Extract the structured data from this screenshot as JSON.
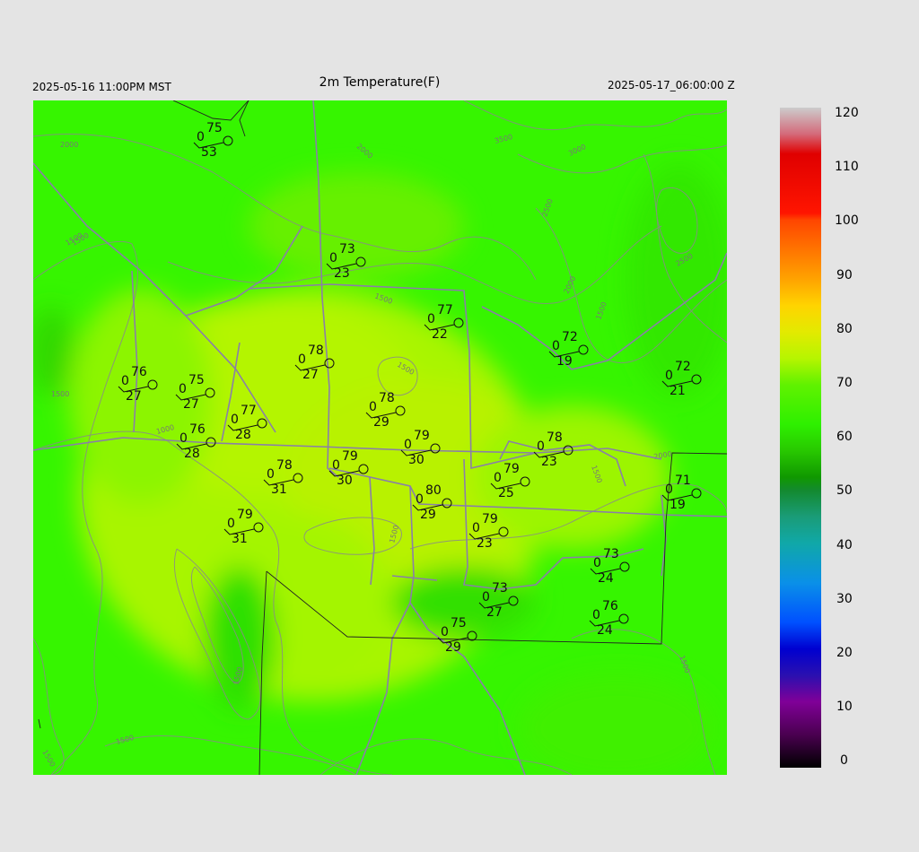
{
  "header": {
    "local_time": "2025-05-16 11:00PM MST",
    "title": "2m Temperature(F)",
    "utc_time": "2025-05-17_06:00:00 Z"
  },
  "colorbar": {
    "labels": [
      "120",
      "110",
      "100",
      "90",
      "80",
      "70",
      "60",
      "50",
      "40",
      "30",
      "20",
      "10",
      "0"
    ]
  },
  "contours": [
    "2000",
    "1500",
    "1000",
    "2000",
    "3500",
    "3000",
    "2500",
    "2000",
    "2500",
    "1500",
    "1500",
    "1500",
    "1500",
    "1500",
    "2000",
    "1500",
    "1500",
    "1500",
    "1500",
    "1500",
    "1500"
  ],
  "stations": [
    {
      "t": "75",
      "g": "0",
      "d": "53"
    },
    {
      "t": "73",
      "g": "0",
      "d": "23"
    },
    {
      "t": "77",
      "g": "0",
      "d": "22"
    },
    {
      "t": "72",
      "g": "0",
      "d": "19"
    },
    {
      "t": "72",
      "g": "0",
      "d": "21"
    },
    {
      "t": "76",
      "g": "0",
      "d": "27"
    },
    {
      "t": "75",
      "g": "0",
      "d": "27"
    },
    {
      "t": "78",
      "g": "0",
      "d": "27"
    },
    {
      "t": "78",
      "g": "0",
      "d": "29"
    },
    {
      "t": "77",
      "g": "0",
      "d": "28"
    },
    {
      "t": "76",
      "g": "0",
      "d": "28"
    },
    {
      "t": "79",
      "g": "0",
      "d": "30"
    },
    {
      "t": "79",
      "g": "0",
      "d": "30"
    },
    {
      "t": "78",
      "g": "0",
      "d": "23"
    },
    {
      "t": "78",
      "g": "0",
      "d": "31"
    },
    {
      "t": "79",
      "g": "0",
      "d": "25"
    },
    {
      "t": "80",
      "g": "0",
      "d": "29"
    },
    {
      "t": "71",
      "g": "0",
      "d": "19"
    },
    {
      "t": "79",
      "g": "0",
      "d": "31"
    },
    {
      "t": "79",
      "g": "0",
      "d": "23"
    },
    {
      "t": "73",
      "g": "0",
      "d": "24"
    },
    {
      "t": "73",
      "g": "0",
      "d": "27"
    },
    {
      "t": "76",
      "g": "0",
      "d": "24"
    },
    {
      "t": "75",
      "g": "0",
      "d": "29"
    }
  ]
}
